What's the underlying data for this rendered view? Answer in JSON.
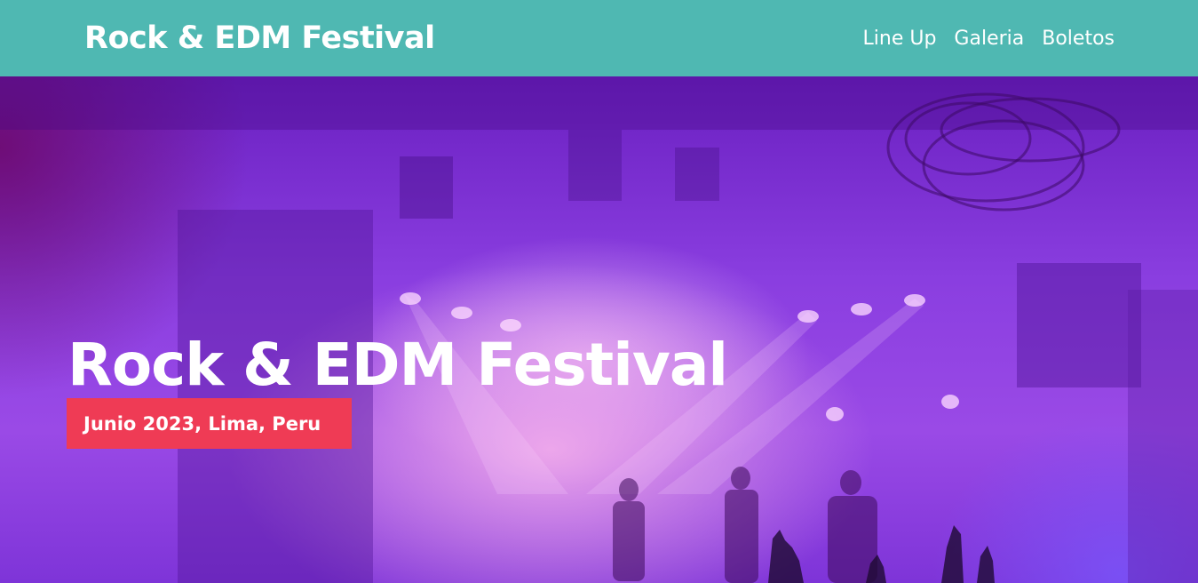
{
  "header": {
    "logo": "Rock & EDM Festival",
    "nav": [
      {
        "label": "Line Up"
      },
      {
        "label": "Galeria"
      },
      {
        "label": "Boletos"
      }
    ]
  },
  "hero": {
    "title": "Rock & EDM Festival",
    "date_badge": "Junio 2023, Lima, Peru",
    "background_image": "concert-stage-photo"
  },
  "colors": {
    "header_bg": "#4fb8b2",
    "badge_bg": "#ef3b55",
    "hero_tint": "#8a3ee0"
  }
}
